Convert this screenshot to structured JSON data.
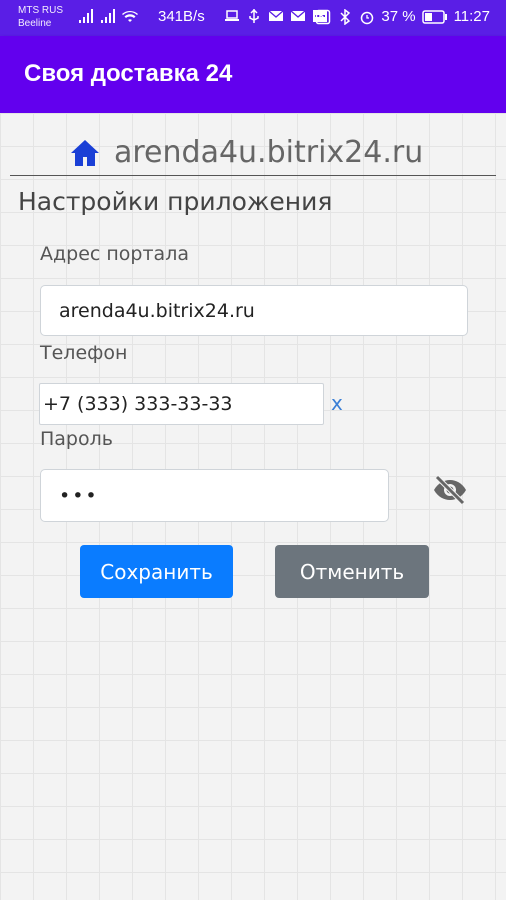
{
  "status_bar": {
    "carrier_1": "MTS RUS",
    "carrier_2": "Beeline",
    "speed": "341B/s",
    "battery": "37 %",
    "time": "11:27"
  },
  "app_bar": {
    "title": "Своя доставка 24"
  },
  "header": {
    "portal": "arenda4u.bitrix24.ru"
  },
  "page": {
    "title": "Настройки приложения"
  },
  "form": {
    "portal_label": "Адрес портала",
    "portal_value": "arenda4u.bitrix24.ru",
    "phone_label": "Телефон",
    "phone_value": "+7 (333) 333-33-33",
    "phone_clear": "x",
    "password_label": "Пароль",
    "password_value": "•••"
  },
  "buttons": {
    "save": "Сохранить",
    "cancel": "Отменить"
  },
  "colors": {
    "app_bar": "#6200ee",
    "status_bar": "#5a1ee6",
    "home_icon": "#1a3fd6",
    "save_button": "#0a7cff",
    "cancel_button": "#6c757d"
  }
}
